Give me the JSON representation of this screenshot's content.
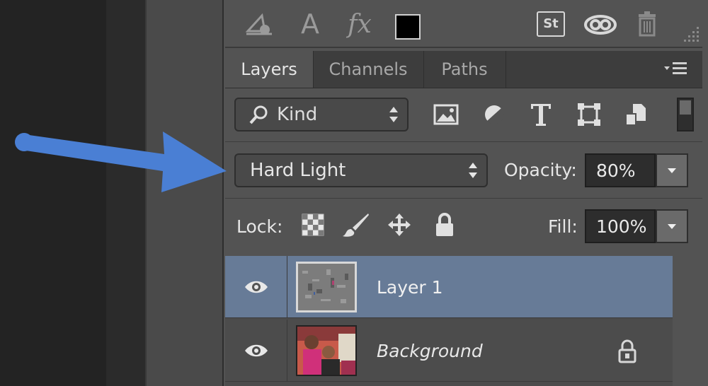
{
  "tabs": [
    {
      "label": "Layers",
      "active": true
    },
    {
      "label": "Channels",
      "active": false
    },
    {
      "label": "Paths",
      "active": false
    }
  ],
  "toolbar": {
    "text_tool_glyph": "A",
    "fx_glyph": "fx",
    "stock_label": "St",
    "foreground_color": "#000000"
  },
  "filter": {
    "kind_label": "Kind"
  },
  "blend": {
    "mode": "Hard Light",
    "opacity_label": "Opacity:",
    "opacity_value": "80%"
  },
  "lock": {
    "label": "Lock:",
    "fill_label": "Fill:",
    "fill_value": "100%"
  },
  "layers": [
    {
      "name": "Layer 1",
      "visible": true,
      "selected": true,
      "locked": false
    },
    {
      "name": "Background",
      "visible": true,
      "selected": false,
      "locked": true
    }
  ],
  "colors": {
    "panel": "#535353",
    "selected_row": "#677b97",
    "annotation_arrow": "#4a7fd4"
  }
}
